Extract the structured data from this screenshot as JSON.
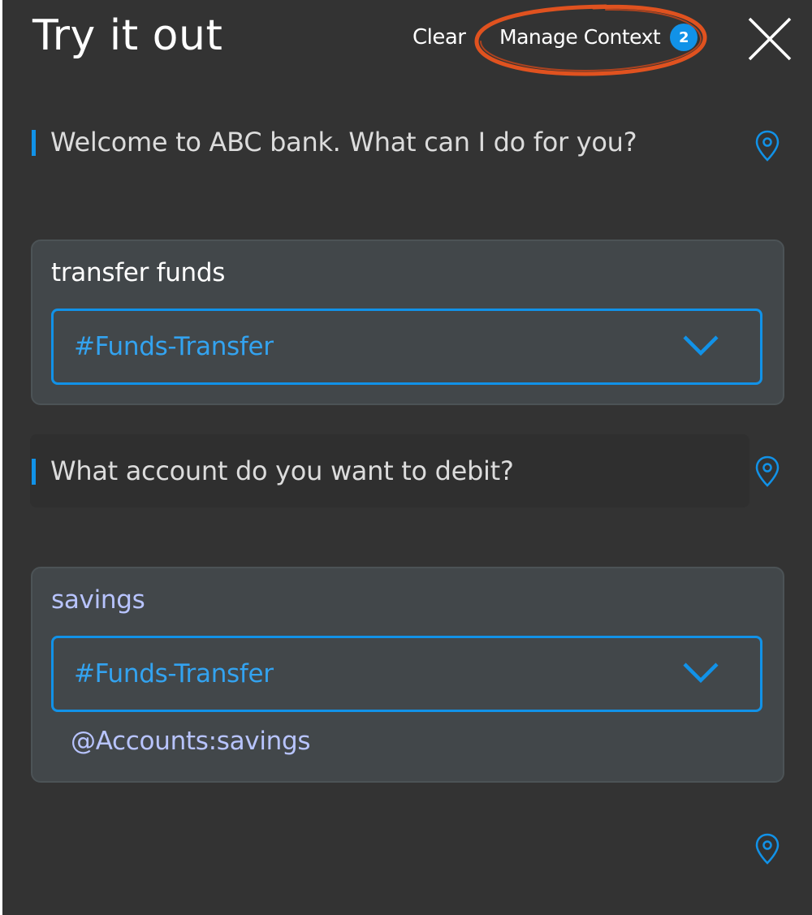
{
  "header": {
    "title": "Try it out",
    "clear_label": "Clear",
    "manage_context_label": "Manage Context",
    "context_count": "2"
  },
  "conversation": {
    "bot_message_1": "Welcome to ABC bank. What can I do for you?",
    "user_message_1": "transfer funds",
    "intent_1": "#Funds-Transfer",
    "bot_message_2": "What account do you want to debit?",
    "user_message_2": "savings",
    "intent_2": "#Funds-Transfer",
    "entity_2": "@Accounts:savings"
  },
  "colors": {
    "panel_bg": "#333333",
    "card_bg": "#42474a",
    "accent_blue": "#1192e8",
    "entity_lavender": "#b8c4ff",
    "highlight_orange": "#e0521f"
  },
  "icons": [
    "close-icon",
    "location-pin-icon",
    "chevron-down-icon"
  ]
}
